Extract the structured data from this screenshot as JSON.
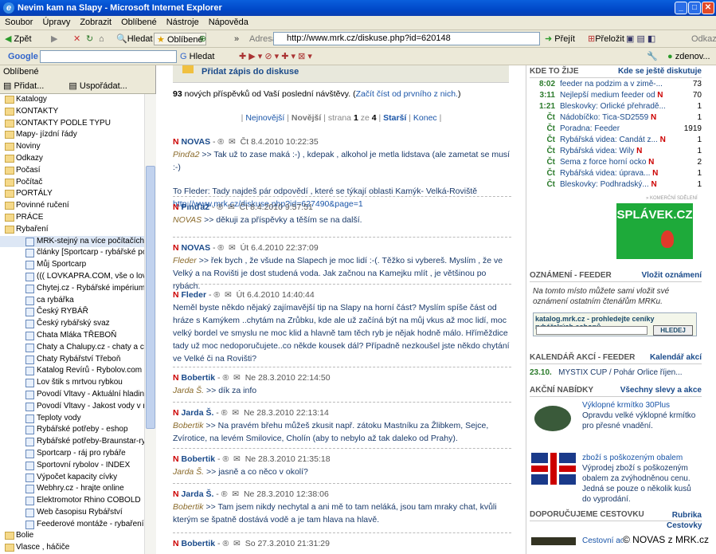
{
  "window": {
    "title": "Nevim kam na Slapy - Microsoft Internet Explorer"
  },
  "menu": [
    "Soubor",
    "Úpravy",
    "Zobrazit",
    "Oblíbené",
    "Nástroje",
    "Nápověda"
  ],
  "toolbar": {
    "back": "Zpět",
    "search": "Hledat",
    "favorites": "Oblíbené",
    "address_label": "Adresa",
    "url": "http://www.mrk.cz/diskuse.php?id=620148",
    "go": "Přejít",
    "translate": "Přeložit",
    "links": "Odkazy"
  },
  "google": {
    "logo": "Google",
    "search_label": "Hledat",
    "user": "zdenov..."
  },
  "sidebar": {
    "title": "Oblíbené",
    "add": "Přidat...",
    "organize": "Uspořádat...",
    "items": [
      {
        "label": "Katalogy",
        "type": "folder"
      },
      {
        "label": "KONTAKTY",
        "type": "folder"
      },
      {
        "label": "KONTAKTY PODLE TYPU",
        "type": "folder"
      },
      {
        "label": "Mapy- jízdní řády",
        "type": "folder"
      },
      {
        "label": "Noviny",
        "type": "folder"
      },
      {
        "label": "Odkazy",
        "type": "folder"
      },
      {
        "label": "Počasí",
        "type": "folder"
      },
      {
        "label": "Počítač",
        "type": "folder"
      },
      {
        "label": "PORTÁLY",
        "type": "folder"
      },
      {
        "label": "Povinné ručení",
        "type": "folder"
      },
      {
        "label": "PRÁCE",
        "type": "folder"
      },
      {
        "label": "Rybaření",
        "type": "folder"
      },
      {
        "label": "MRK-stejný na více počítačích",
        "type": "sub",
        "selected": true
      },
      {
        "label": "články [Sportcarp - rybářské pot...",
        "type": "sub"
      },
      {
        "label": "Můj Sportcarp",
        "type": "sub"
      },
      {
        "label": "((( LOVKAPRA.COM, vše o lovu ...",
        "type": "sub"
      },
      {
        "label": "Chytej.cz - Rybářské impérium (...",
        "type": "sub"
      },
      {
        "label": "ca rybářka",
        "type": "sub"
      },
      {
        "label": "Český RYBÁŘ",
        "type": "sub"
      },
      {
        "label": "Český rybářský svaz",
        "type": "sub"
      },
      {
        "label": "Chata Mláka TŘEBOŇ",
        "type": "sub"
      },
      {
        "label": "Chaty a Chalupy.cz - chaty a cha...",
        "type": "sub"
      },
      {
        "label": "Chaty Rybářství Třeboň",
        "type": "sub"
      },
      {
        "label": "Katalog Revírů - Rybolov.com - i...",
        "type": "sub"
      },
      {
        "label": "Lov štik s mrtvou rybkou",
        "type": "sub"
      },
      {
        "label": "Povodí Vltavy - Aktuální hladina ...",
        "type": "sub"
      },
      {
        "label": "Povodí Vltavy - Jakost vody v ná...",
        "type": "sub"
      },
      {
        "label": "Teploty vody",
        "type": "sub"
      },
      {
        "label": "Rybářské potřeby - eshop",
        "type": "sub"
      },
      {
        "label": "Rybářské potřeby-Braunstar-ryba...",
        "type": "sub"
      },
      {
        "label": "Sportcarp - ráj pro rybáře",
        "type": "sub"
      },
      {
        "label": "Sportovní rybolov - INDEX",
        "type": "sub"
      },
      {
        "label": "Výpočet kapacity cívky",
        "type": "sub"
      },
      {
        "label": "Webhry.cz - hrajte online",
        "type": "sub"
      },
      {
        "label": "Elektromotor Rhino COBOLD",
        "type": "sub"
      },
      {
        "label": "Web časopisu Rybářství",
        "type": "sub"
      },
      {
        "label": "Feederové montáže - rybaření s ...",
        "type": "sub"
      },
      {
        "label": "Bolie",
        "type": "folder"
      },
      {
        "label": "Vlasce , háčiče",
        "type": "folder"
      }
    ]
  },
  "content": {
    "add_topic": "Přidat zápis do diskuse",
    "new_count": "93",
    "new_text": " nových příspěvků od Vaší poslední návštěvy. (",
    "new_link": "Začít číst od prvního z nich.",
    "new_end": ")",
    "pager": {
      "newest": "Nejnovější",
      "newer": "Novější",
      "page_label": "strana",
      "page": "1",
      "of": "ze",
      "total": "4",
      "older": "Starší",
      "last": "Konec"
    },
    "posts": [
      {
        "author": "NOVAS",
        "meta": "Čt 8.4.2010 10:22:35",
        "quote_author": "Pinďa2",
        "text": ">> Tak už to zase maká :-) , kdepak , alkohol je metla lidstava (ale zametat se musí :-)",
        "extra": "To Fleder: Tady najdeš pár odpovědí , které se týkají oblasti Kamýk- Velká-Roviště",
        "link": "http://www.mrk.cz/diskuse.php?id=627490&page=1"
      },
      {
        "author": "Pinďa2",
        "meta": "Čt 8.4.2010 9:57:51",
        "quote_author": "NOVAS",
        "text": ">> děkuji za příspěvky a těším se na další."
      },
      {
        "author": "NOVAS",
        "meta": "Út 6.4.2010 22:37:09",
        "quote_author": "Fleder",
        "text": ">> řek bych , že všude na Slapech je moc lidí :-(. Těžko si vybereš. Myslím , že ve Velký a na Rovišti je dost studená voda. Jak začnou na Kamejku mlít , je většinou po rybách."
      },
      {
        "author": "Fleder",
        "meta": "Út 6.4.2010 14:40:44",
        "quote_author": "",
        "text": "Neměl byste někdo nějaký zajímavější tip na Slapy na horní část? Myslím spíše část od hráze s Kamýkem ..chytám na Zrůbku, kde ale už začíná být na můj vkus až moc lidí, moc velký bordel ve smyslu ne moc klid a hlavně tam těch ryb je nějak hodně málo. Hříměždice tady už moc nedoporučujete..co někde kousek dál? Případně nezkoušel jste někdo chytání ve Velké či na Rovišti?"
      },
      {
        "author": "Bobertik",
        "meta": "Ne 28.3.2010 22:14:50",
        "quote_author": "Jarda Š.",
        "text": ">> dík za info"
      },
      {
        "author": "Jarda Š.",
        "meta": "Ne 28.3.2010 22:13:14",
        "quote_author": "Bobertik",
        "text": ">> Na pravém břehu můžeš zkusit např. zátoku Mastníku za Žlibkem, Sejce, Zvírotice, na levém Smilovice, Cholín (aby to nebylo až tak daleko od Prahy)."
      },
      {
        "author": "Bobertik",
        "meta": "Ne 28.3.2010 21:35:18",
        "quote_author": "Jarda Š.",
        "text": ">> jasně a co něco v okolí?"
      },
      {
        "author": "Jarda Š.",
        "meta": "Ne 28.3.2010 12:38:06",
        "quote_author": "Bobertik",
        "text": ">> Tam jsem nikdy nechytal a ani mě to tam neláká, jsou tam mraky chat, kvůli kterým se špatně dostává vodě a je tam hlava na hlavě."
      },
      {
        "author": "Bobertik",
        "meta": "So 27.3.2010 21:31:29",
        "quote_author": "",
        "text": ""
      }
    ]
  },
  "right": {
    "kde_title": "KDE TO ŽIJE",
    "kde_link": "Kde se ještě diskutuje",
    "kde_rows": [
      {
        "time": "8:02",
        "text": "feeder na podzim a v zimě-...",
        "count": "73",
        "hot": false
      },
      {
        "time": "3:11",
        "text": "Nejlepší medium feeder od",
        "count": "70",
        "hot": true
      },
      {
        "time": "1:21",
        "text": "Bleskovky: Orlické přehradě...",
        "count": "1",
        "hot": false
      },
      {
        "time": "Čt",
        "text": "Nádobíčko: Tica-SD2559",
        "count": "1",
        "hot": true
      },
      {
        "time": "Čt",
        "text": "Poradna: Feeder",
        "count": "1919",
        "hot": false
      },
      {
        "time": "Čt",
        "text": "Rybářská videa: Candát z...",
        "count": "1",
        "hot": true
      },
      {
        "time": "Čt",
        "text": "Rybářská videa: Wily",
        "count": "1",
        "hot": true
      },
      {
        "time": "Čt",
        "text": "Sema z force horní ocko",
        "count": "2",
        "hot": true
      },
      {
        "time": "Čt",
        "text": "Rybářská videa: úprava...",
        "count": "1",
        "hot": true
      },
      {
        "time": "Čt",
        "text": "Bleskovky: Podhradský...",
        "count": "1",
        "hot": true
      }
    ],
    "ad_label": "» KOMERČNÍ SDĚLENÍ",
    "splavek": "SPLÁVEK.CZ",
    "ozn_title": "OZNÁMENÍ - FEEDER",
    "ozn_link": "Vložit oznámení",
    "ozn_text": "Na tomto místo můžete sami vložit své oznámení ostatním čtenářům MRKu.",
    "katalog": "katalog.mrk.cz - prohledejte ceníky rybářských eshopů",
    "katalog_btn": "HLEDEJ",
    "kal_title": "KALENDÁŘ AKCÍ - FEEDER",
    "kal_link": "Kalendář akcí",
    "kal_date": "23.10.",
    "kal_text": "MYSTIX CUP / Pohár Orlice říjen...",
    "akce_title": "AKČNÍ NABÍDKY",
    "akce_link": "Všechny slevy a akce",
    "akce1_title": "Výklopné krmítko 30Plus",
    "akce1_text": "Opravdu velké výklopné krmítko pro přesné vnadění.",
    "akce2_title": "zboží s poškozeným obalem",
    "akce2_text": "Výprodej zboží s poškozeným obalem za zvýhodněnou cenu. Jedná se pouze o několik kusů do vyprodání.",
    "doporuc_title": "DOPORUČUJEME CESTOVKU",
    "doporuc_link": "Rubrika Cestovky",
    "cestovni": "Cestovní ao..."
  },
  "watermark": "© NOVAS z MRK.cz"
}
